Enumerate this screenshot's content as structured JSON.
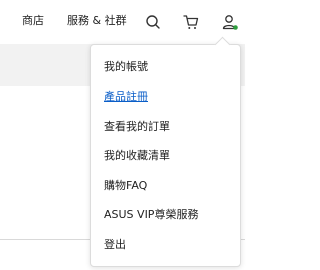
{
  "nav": {
    "shop_label": "商店",
    "service_label": "服務 & 社群",
    "search_icon": "search-icon",
    "cart_icon": "cart-icon",
    "user_icon": "user-icon",
    "user_status_color": "#2e9e3e"
  },
  "account_menu": {
    "items": [
      {
        "label": "我的帳號"
      },
      {
        "label": "產品註冊",
        "style": "link",
        "color": "#0a5ec8"
      },
      {
        "label": "查看我的訂單"
      },
      {
        "label": "我的收藏清單"
      },
      {
        "label": "購物FAQ"
      },
      {
        "label": "ASUS VIP尊榮服務"
      },
      {
        "label": "登出"
      }
    ]
  }
}
